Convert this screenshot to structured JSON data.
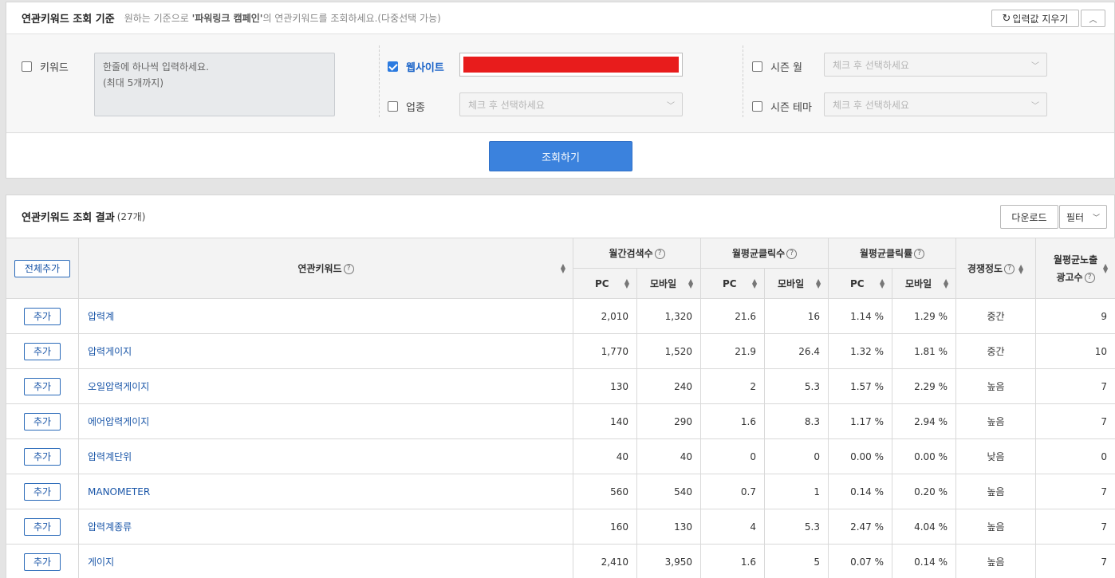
{
  "criteria": {
    "title": "연관키워드 조회 기준",
    "desc_prefix": "원하는 기준으로",
    "desc_campaign": "'파워링크 캠페인'",
    "desc_suffix": "의 연관키워드를 조회하세요.(다중선택 가능)",
    "clear_label": "입력값 지우기",
    "keyword": {
      "label": "키워드",
      "checked": false,
      "placeholder": "한줄에 하나씩 입력하세요.\n(최대 5개까지)"
    },
    "website": {
      "label": "웹사이트",
      "checked": true
    },
    "industry": {
      "label": "업종",
      "checked": false,
      "placeholder": "체크 후 선택하세요"
    },
    "season_month": {
      "label": "시즌 월",
      "checked": false,
      "placeholder": "체크 후 선택하세요"
    },
    "season_theme": {
      "label": "시즌 테마",
      "checked": false,
      "placeholder": "체크 후 선택하세요"
    },
    "search_label": "조회하기"
  },
  "results": {
    "title": "연관키워드 조회 결과",
    "count": "(27개)",
    "download_label": "다운로드",
    "filter_label": "필터",
    "add_all_label": "전체추가",
    "add_label": "추가",
    "headers": {
      "keyword": "연관키워드",
      "monthly_search": "월간검색수",
      "avg_clicks": "월평균클릭수",
      "avg_ctr": "월평균클릭률",
      "competition": "경쟁정도",
      "avg_ads_line1": "월평균노출",
      "avg_ads_line2": "광고수",
      "pc": "PC",
      "mobile": "모바일"
    },
    "rows": [
      {
        "keyword": "압력계",
        "search_pc": "2,010",
        "search_mobile": "1,320",
        "clicks_pc": "21.6",
        "clicks_mobile": "16",
        "ctr_pc": "1.14 %",
        "ctr_mobile": "1.29 %",
        "competition": "중간",
        "ads": "9"
      },
      {
        "keyword": "압력게이지",
        "search_pc": "1,770",
        "search_mobile": "1,520",
        "clicks_pc": "21.9",
        "clicks_mobile": "26.4",
        "ctr_pc": "1.32 %",
        "ctr_mobile": "1.81 %",
        "competition": "중간",
        "ads": "10"
      },
      {
        "keyword": "오일압력게이지",
        "search_pc": "130",
        "search_mobile": "240",
        "clicks_pc": "2",
        "clicks_mobile": "5.3",
        "ctr_pc": "1.57 %",
        "ctr_mobile": "2.29 %",
        "competition": "높음",
        "ads": "7"
      },
      {
        "keyword": "에어압력게이지",
        "search_pc": "140",
        "search_mobile": "290",
        "clicks_pc": "1.6",
        "clicks_mobile": "8.3",
        "ctr_pc": "1.17 %",
        "ctr_mobile": "2.94 %",
        "competition": "높음",
        "ads": "7"
      },
      {
        "keyword": "압력계단위",
        "search_pc": "40",
        "search_mobile": "40",
        "clicks_pc": "0",
        "clicks_mobile": "0",
        "ctr_pc": "0.00 %",
        "ctr_mobile": "0.00 %",
        "competition": "낮음",
        "ads": "0"
      },
      {
        "keyword": "MANOMETER",
        "search_pc": "560",
        "search_mobile": "540",
        "clicks_pc": "0.7",
        "clicks_mobile": "1",
        "ctr_pc": "0.14 %",
        "ctr_mobile": "0.20 %",
        "competition": "높음",
        "ads": "7"
      },
      {
        "keyword": "압력계종류",
        "search_pc": "160",
        "search_mobile": "130",
        "clicks_pc": "4",
        "clicks_mobile": "5.3",
        "ctr_pc": "2.47 %",
        "ctr_mobile": "4.04 %",
        "competition": "높음",
        "ads": "7"
      },
      {
        "keyword": "게이지",
        "search_pc": "2,410",
        "search_mobile": "3,950",
        "clicks_pc": "1.6",
        "clicks_mobile": "5",
        "ctr_pc": "0.07 %",
        "ctr_mobile": "0.14 %",
        "competition": "높음",
        "ads": "7"
      }
    ]
  }
}
